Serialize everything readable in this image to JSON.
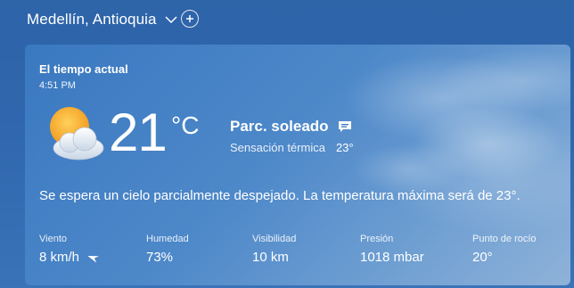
{
  "header": {
    "location": "Medellín, Antioquia"
  },
  "current": {
    "label": "El tiempo actual",
    "time": "4:51 PM",
    "temperature": "21",
    "unit": "°C",
    "condition": "Parc. soleado",
    "feels_like_label": "Sensación térmica",
    "feels_like_value": "23°",
    "summary": "Se espera un cielo parcialmente despejado. La temperatura máxima será de 23°."
  },
  "stats": [
    {
      "label": "Viento",
      "value": "8 km/h"
    },
    {
      "label": "Humedad",
      "value": "73%"
    },
    {
      "label": "Visibilidad",
      "value": "10 km"
    },
    {
      "label": "Presión",
      "value": "1018 mbar"
    },
    {
      "label": "Punto de rocío",
      "value": "20°"
    }
  ],
  "icons": {
    "weather": "partly-sunny-icon",
    "condition_detail": "message-icon",
    "wind_direction": "wind-arrow-icon",
    "dropdown": "chevron-down-icon",
    "add": "plus-icon"
  },
  "colors": {
    "background": "#2e64a8",
    "sun": "#f5a623",
    "cloud": "#e8eef6"
  }
}
